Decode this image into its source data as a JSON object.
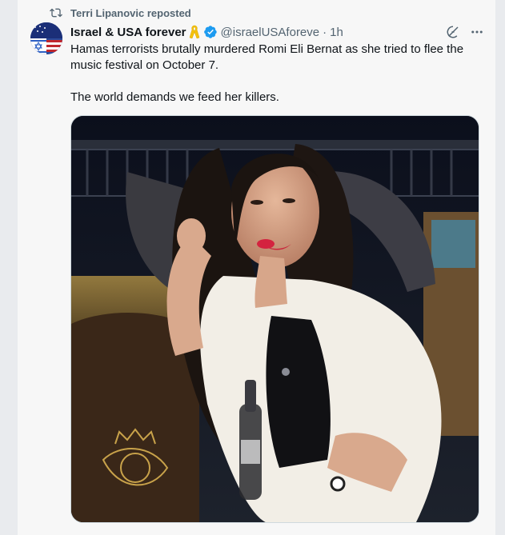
{
  "repost": {
    "icon": "repost-icon",
    "label": "Terri Lipanovic reposted"
  },
  "author": {
    "display_name": "Israel & USA forever",
    "badge_emoji": "yellow-ribbon-icon",
    "verified": true,
    "handle": "@israelUSAforeve",
    "separator": "·",
    "time": "1h"
  },
  "tweet": {
    "paragraphs": [
      "Hamas terrorists brutally murdered Romi Eli Bernat as she tried to flee the music festival on October 7.",
      "The world demands we feed her killers."
    ]
  },
  "colors": {
    "accent": "#1d9bf0",
    "secondary_text": "#536471",
    "primary_text": "#0f1419"
  }
}
